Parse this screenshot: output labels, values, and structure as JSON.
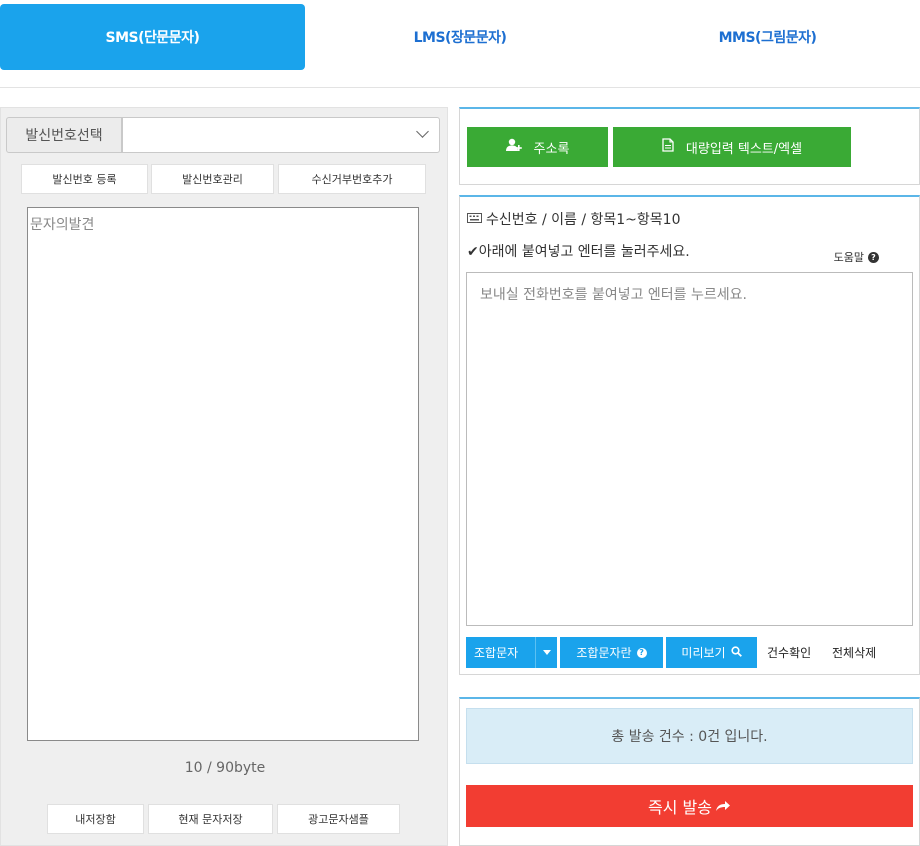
{
  "tabs": [
    {
      "label": "SMS(단문문자)",
      "active": true
    },
    {
      "label": "LMS(장문문자)",
      "active": false
    },
    {
      "label": "MMS(그림문자)",
      "active": false
    }
  ],
  "sender": {
    "label": "발신번호선택",
    "selected_value": ""
  },
  "sender_buttons": {
    "register": "발신번호 등록",
    "manage": "발신번호관리",
    "reject_add": "수신거부번호추가"
  },
  "message": {
    "text": "문자의발견",
    "byte_count": "10 / 90byte"
  },
  "bottom_buttons": {
    "my_storage": "내저장함",
    "save_current": "현재 문자저장",
    "ad_samples": "광고문자샘플"
  },
  "contacts": {
    "address_book": "주소록",
    "bulk_input": "대량입력 텍스트/엑셀"
  },
  "recipients": {
    "title": "수신번호 / 이름 / 항목1~항목10",
    "hint": "✔아래에 붙여넣고 엔터를 눌러주세요.",
    "help": "도움말",
    "placeholder": "보내실 전화번호를 붙여넣고 엔터를 누르세요."
  },
  "toolbar": {
    "merge_text": "조합문자",
    "merge_text_help": "조합문자란",
    "preview": "미리보기",
    "count_check": "건수확인",
    "delete_all": "전체삭제"
  },
  "send": {
    "total_text": "총 발송 건수 : 0건 입니다.",
    "send_now": "즉시 발송"
  },
  "colors": {
    "accent_blue": "#1aa3ec",
    "green": "#3aaa35",
    "red": "#f23d32",
    "info_bg": "#d9edf7"
  }
}
